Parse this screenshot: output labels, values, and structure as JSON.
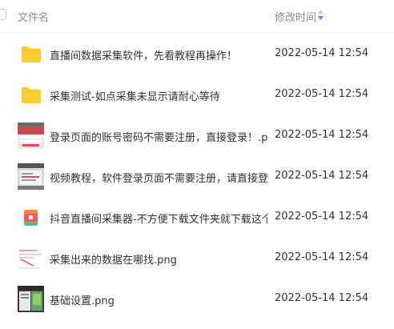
{
  "header": {
    "name_label": "文件名",
    "time_label": "修改时间",
    "sort_icon": "sort-icon",
    "accent": "#3b96ff"
  },
  "files": [
    {
      "name": "直播间数据采集软件，先看教程再操作！",
      "time": "2022-05-14 12:54",
      "kind": "folder",
      "icon": "folder-icon"
    },
    {
      "name": "采集测试-如点采集未显示请耐心等待",
      "time": "2022-05-14 12:54",
      "kind": "folder",
      "icon": "folder-icon"
    },
    {
      "name": "登录页面的账号密码不需要注册，直接登录！.png",
      "time": "2022-05-14 12:54",
      "kind": "image",
      "icon": "image-thumbnail"
    },
    {
      "name": "视频教程，软件登录页面不需要注册，请直接登...",
      "time": "2022-05-14 12:54",
      "kind": "image",
      "icon": "image-thumbnail"
    },
    {
      "name": "抖音直播间采集器-不方便下载文件夹就下载这个...",
      "time": "2022-05-14 12:54",
      "kind": "app",
      "icon": "app-icon"
    },
    {
      "name": "采集出来的数据在哪找.png",
      "time": "2022-05-14 12:54",
      "kind": "image",
      "icon": "image-thumbnail"
    },
    {
      "name": "基础设置.png",
      "time": "2022-05-14 12:54",
      "kind": "image",
      "icon": "image-thumbnail"
    }
  ],
  "colors": {
    "folder": "#ffcc33",
    "text": "#333333",
    "header_text": "#888d96"
  }
}
